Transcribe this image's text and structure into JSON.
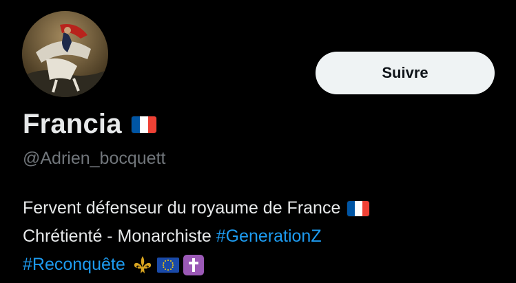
{
  "profile": {
    "display_name": "Francia",
    "name_emoji": "flag-france-icon",
    "handle": "@Adrien_bocquett",
    "avatar": "napoleon-crossing-alps-painting"
  },
  "actions": {
    "follow_label": "Suivre"
  },
  "bio": {
    "line1_text": "Fervent défenseur du royaume de France",
    "line2_text": "Chrétienté - Monarchiste",
    "hashtag_generationz": "#GenerationZ",
    "hashtag_reconquete": "#Reconquête",
    "emojis": [
      "flag-france-icon",
      "fleur-de-lis-icon",
      "flag-eu-icon",
      "latin-cross-icon"
    ]
  },
  "colors": {
    "background": "#000000",
    "text_primary": "#e7e9ea",
    "text_secondary": "#71767b",
    "link": "#1d9bf0",
    "button_bg": "#eff3f4",
    "button_text": "#0f1419"
  }
}
